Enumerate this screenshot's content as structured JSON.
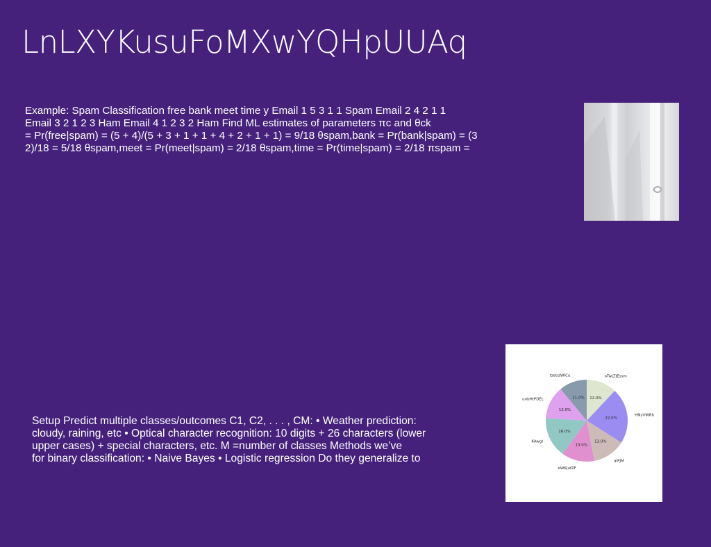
{
  "slide": {
    "title": "LnLXYKusuFoMXwYQHpUUAq",
    "paragraph1": "Example: Spam Classification free bank meet time y Email 1 5 3 1 1 Spam Email 2 4 2 1 1\nEmail 3 2 1 2 3 Ham Email 4 1 2 3 2 Ham Find ML estimates of parameters πc and θck\n= Pr(free|spam) = (5 + 4)/(5 + 3 + 1 + 1 + 4 + 2 + 1 + 1) = 9/18 θspam,bank = Pr(bank|spam) = (3\n2)/18 = 5/18 θspam,meet = Pr(meet|spam) = 2/18 θspam,time = Pr(time|spam) = 2/18 πspam =",
    "paragraph2": "Setup Predict multiple classes/outcomes C1, C2, . . . , CM: • Weather prediction:\ncloudy, raining, etc • Optical character recognition: 10 digits + 26 characters (lower\nupper cases) + special characters, etc. M =number of classes Methods we’ve\nfor binary classification: • Naive Bayes • Logistic regression Do they generalize to"
  },
  "chart_data": {
    "type": "pie",
    "labels": [
      "oTwLTJEssm",
      "HNyVWRh",
      "aIPJM",
      "oWKjufZF",
      "KAwgI",
      "unbHtPDEc",
      "tzeUzWICu"
    ],
    "values": [
      12.0,
      22.0,
      13.0,
      13.0,
      16.0,
      13.0,
      11.0
    ],
    "value_labels": [
      "12.0%",
      "22.0%",
      "13.0%",
      "13.0%",
      "16.0%",
      "13.0%",
      "11.0%"
    ],
    "colors": [
      "#dfe6cf",
      "#9b8cf2",
      "#cdbbb8",
      "#e090cf",
      "#92c8c4",
      "#dda1ee",
      "#879bad"
    ],
    "start_angle_deg": 90,
    "direction": "clockwise"
  }
}
